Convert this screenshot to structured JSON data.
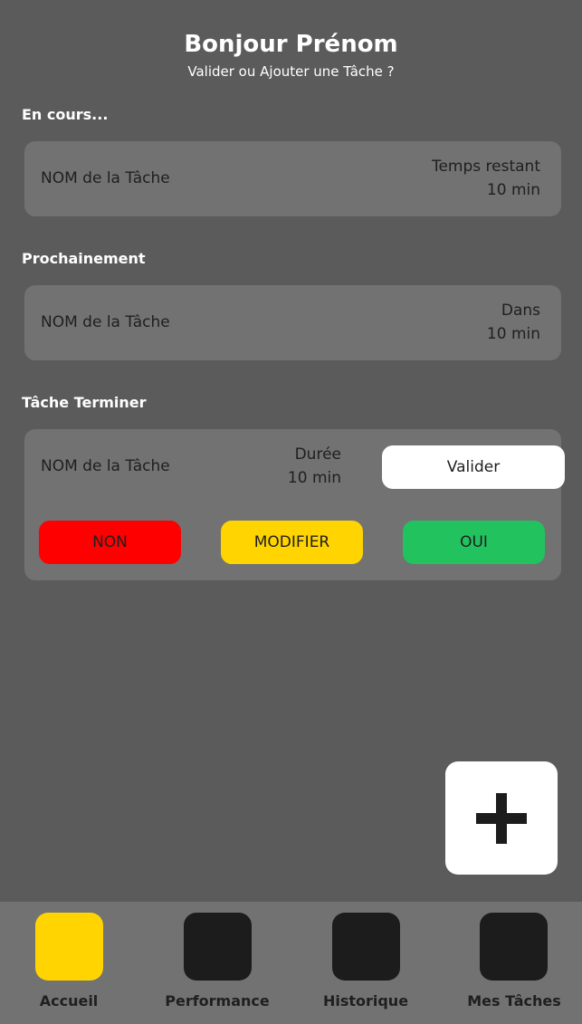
{
  "header": {
    "title": "Bonjour Prénom",
    "subtitle": "Valider ou Ajouter une Tâche ?"
  },
  "sections": {
    "current": {
      "title": "En cours...",
      "task_name": "NOM de la Tâche",
      "meta_label": "Temps restant",
      "meta_value": "10 min"
    },
    "upcoming": {
      "title": "Prochainement",
      "task_name": "NOM de la Tâche",
      "meta_label": "Dans",
      "meta_value": "10 min"
    },
    "finished": {
      "title": "Tâche Terminer",
      "task_name": "NOM de la Tâche",
      "meta_label": "Durée",
      "meta_value": "10 min",
      "validate_label": "Valider"
    }
  },
  "actions": {
    "no_label": "NON",
    "edit_label": "MODIFIER",
    "yes_label": "OUI"
  },
  "fab": {
    "icon": "plus-icon"
  },
  "nav": {
    "items": [
      {
        "label": "Accueil",
        "active": true
      },
      {
        "label": "Performance",
        "active": false
      },
      {
        "label": "Historique",
        "active": false
      },
      {
        "label": "Mes Tâches",
        "active": false
      }
    ]
  },
  "colors": {
    "background": "#5b5b5b",
    "card": "#727272",
    "active_nav": "#ffd400",
    "no": "#ff0000",
    "edit": "#ffd400",
    "yes": "#22c35e"
  }
}
